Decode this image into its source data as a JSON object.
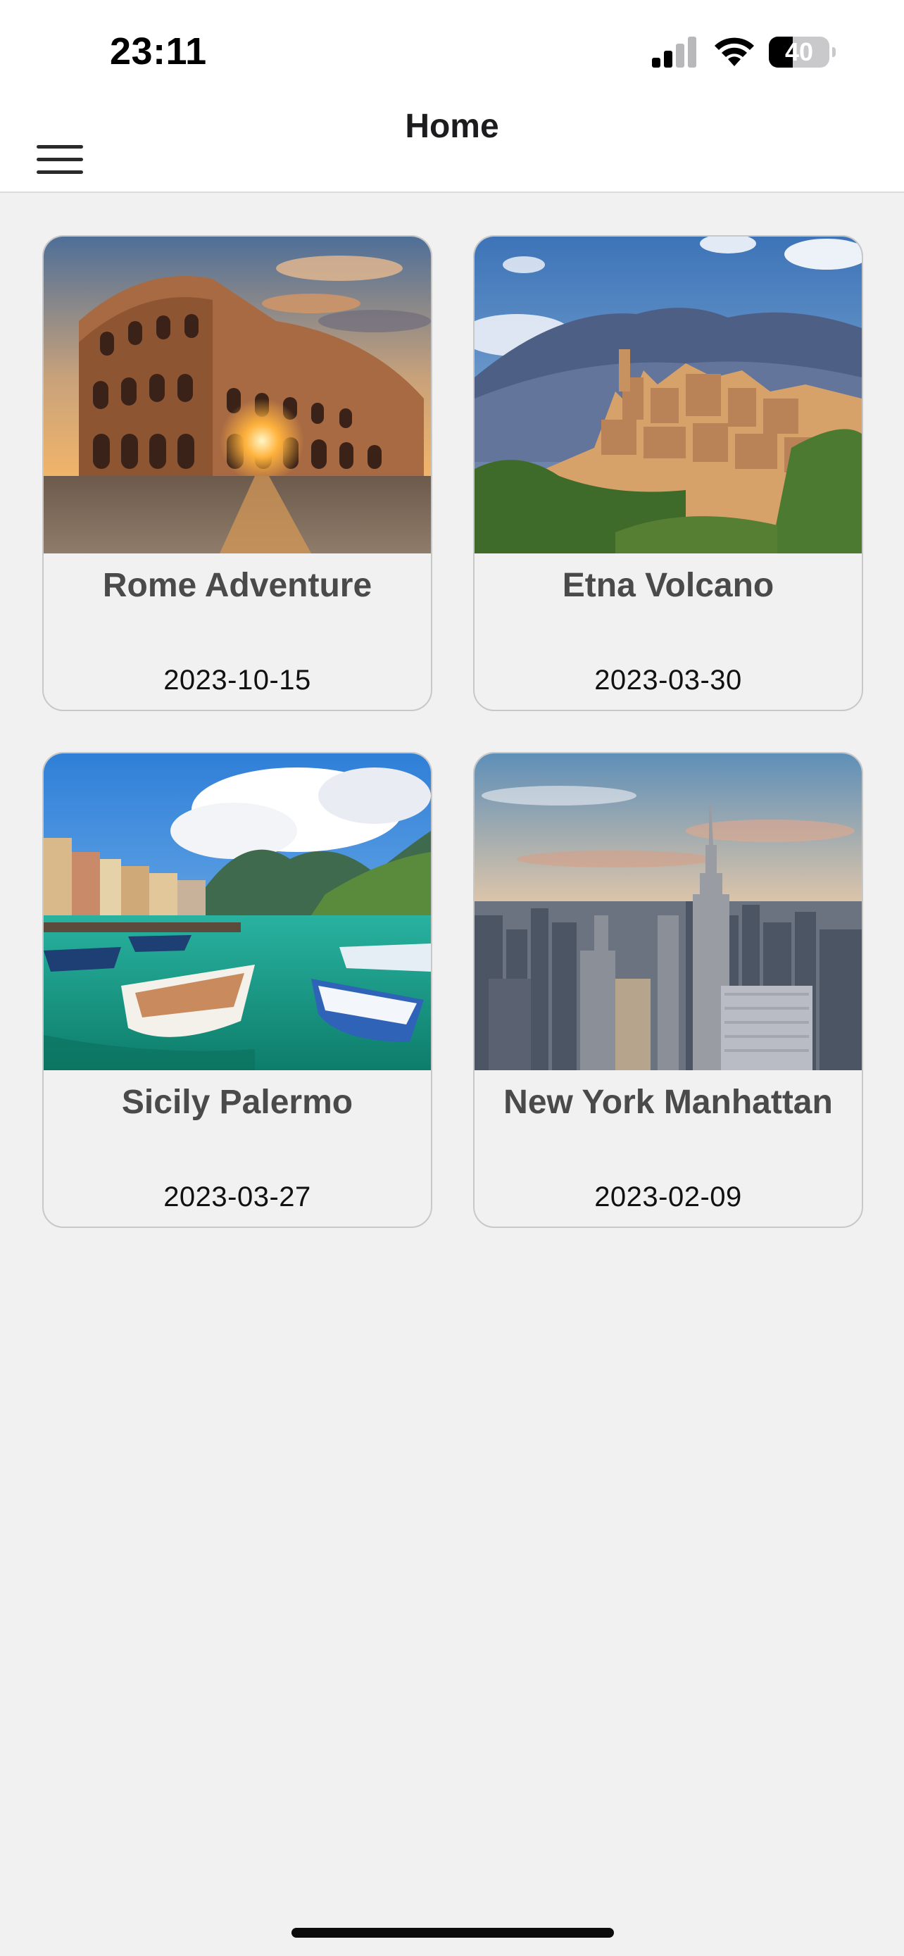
{
  "status_bar": {
    "time": "23:11",
    "battery_level": "40",
    "battery_fraction": 0.4,
    "icons": [
      "cellular-signal-icon",
      "wifi-icon",
      "battery-icon"
    ]
  },
  "nav": {
    "title": "Home",
    "menu_icon": "hamburger-menu-icon"
  },
  "trips": [
    {
      "title": "Rome Adventure",
      "date": "2023-10-15",
      "image": "colosseum-sunset-photo"
    },
    {
      "title": "Etna Volcano",
      "date": "2023-03-30",
      "image": "sicilian-hill-town-photo"
    },
    {
      "title": "Sicily Palermo",
      "date": "2023-03-27",
      "image": "harbor-boats-photo"
    },
    {
      "title": "New York Manhattan",
      "date": "2023-02-09",
      "image": "manhattan-skyline-photo"
    }
  ],
  "colors": {
    "background": "#f1f1f1",
    "bar_background": "#ffffff",
    "title_text": "#4a4a4a",
    "card_border": "#c8c8c8"
  }
}
